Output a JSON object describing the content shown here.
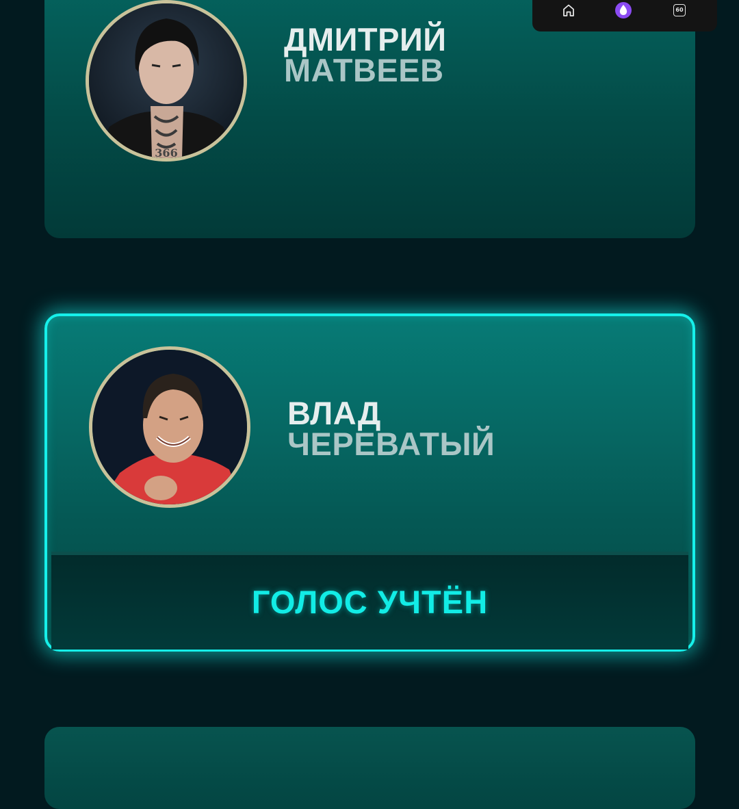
{
  "topbar": {
    "icons": [
      "home-icon",
      "alice-icon",
      "sixty-icon"
    ],
    "sixty_label": "60"
  },
  "candidates": [
    {
      "first_name": "ДМИТРИЙ",
      "last_name": "МАТВЕЕВ",
      "voted": false
    },
    {
      "first_name": "ВЛАД",
      "last_name": "ЧЕРЕВАТЫЙ",
      "voted": true,
      "vote_status": "ГОЛОС УЧТЁН"
    }
  ],
  "colors": {
    "accent": "#16f0ea",
    "card": "#056560",
    "background": "#021a1f",
    "avatar_ring": "#c9c29a",
    "alice": "#8b4bf2"
  }
}
